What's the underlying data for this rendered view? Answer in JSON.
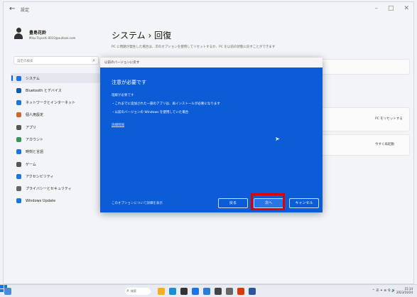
{
  "window": {
    "app_title": "設定",
    "controls": [
      "–",
      "□",
      "✕"
    ]
  },
  "profile": {
    "name": "豊島花鈴",
    "email": "Miku.Toyoshi.0010@outlook.com"
  },
  "search": {
    "placeholder": "設定の検索",
    "icon": "search-icon"
  },
  "sidebar": {
    "items": [
      {
        "label": "システム",
        "icon": "system-icon",
        "color": "#1a73e8",
        "active": true
      },
      {
        "label": "Bluetooth とデバイス",
        "icon": "bluetooth-icon",
        "color": "#1558b0",
        "active": false
      },
      {
        "label": "ネットワークとインターネット",
        "icon": "network-icon",
        "color": "#1a73e8",
        "active": false
      },
      {
        "label": "個人用設定",
        "icon": "personalization-icon",
        "color": "#d6632c",
        "active": false
      },
      {
        "label": "アプリ",
        "icon": "apps-icon",
        "color": "#555555",
        "active": false
      },
      {
        "label": "アカウント",
        "icon": "accounts-icon",
        "color": "#2e9b57",
        "active": false
      },
      {
        "label": "時刻と言語",
        "icon": "time-language-icon",
        "color": "#1a73e8",
        "active": false
      },
      {
        "label": "ゲーム",
        "icon": "gaming-icon",
        "color": "#555555",
        "active": false
      },
      {
        "label": "アクセシビリティ",
        "icon": "accessibility-icon",
        "color": "#1a73e8",
        "active": false
      },
      {
        "label": "プライバシーとセキュリティ",
        "icon": "privacy-icon",
        "color": "#666666",
        "active": false
      },
      {
        "label": "Windows Update",
        "icon": "windows-update-icon",
        "color": "#1a73e8",
        "active": false
      }
    ]
  },
  "main": {
    "title": "システム › 回復",
    "description": "PC に問題が発生した場合は、次のオプションを使用してリセットするか、PC を以前の状態に戻すことができます",
    "card_b_label": "PC をリセットする",
    "card_c_label": "今すぐ再起動"
  },
  "dialog": {
    "caption": "以前のバージョンに戻す",
    "heading": "注意が必要です",
    "subheading": "理解が必要です",
    "bullet_1": "・これまでに追加された一部のアプリは、再インストールが必要になります",
    "bullet_2": "・以前のバージョンの Windows を使用していた場合",
    "link": "詳細情報",
    "footer_link": "このオプションについて詳細を表示",
    "buttons": {
      "back": "戻る",
      "next": "次へ",
      "cancel": "キャンセル"
    }
  },
  "taskbar": {
    "search_label": "検索",
    "tray": "^ あ ✦ ⊕ 令 🔊",
    "clock_time": "15:14",
    "clock_date": "2023/10/24",
    "apps": [
      {
        "icon": "file-explorer-icon",
        "color": "#f2b01e"
      },
      {
        "icon": "edge-icon",
        "color": "#1c8fd4"
      },
      {
        "icon": "store-icon",
        "color": "#333333"
      },
      {
        "icon": "mail-icon",
        "color": "#1a73e8"
      },
      {
        "icon": "photos-icon",
        "color": "#2e7bd6"
      },
      {
        "icon": "terminal-icon",
        "color": "#444444"
      },
      {
        "icon": "settings-icon",
        "color": "#666666"
      },
      {
        "icon": "office-icon",
        "color": "#d83b01"
      },
      {
        "icon": "word-icon",
        "color": "#2b579a"
      }
    ]
  }
}
